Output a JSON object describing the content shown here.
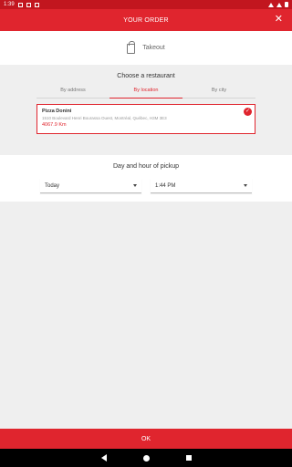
{
  "status_bar": {
    "time": "1:39"
  },
  "app_bar": {
    "title": "YOUR ORDER",
    "close_icon": "close-icon"
  },
  "order_type": {
    "label": "Takeout",
    "icon": "bag-icon"
  },
  "restaurant_picker": {
    "title": "Choose a restaurant",
    "tabs": [
      {
        "label": "By address",
        "active": false
      },
      {
        "label": "By location",
        "active": true
      },
      {
        "label": "By city",
        "active": false
      }
    ],
    "selected": {
      "name": "Pizza Donini",
      "address": "1510 Boulevard Henri Bourassa Ouest, Montréal, Québec, H3M 3E3",
      "distance": "4067.9 Km"
    }
  },
  "pickup": {
    "title": "Day and hour of pickup",
    "day": "Today",
    "time": "1:44 PM"
  },
  "footer": {
    "ok_label": "OK"
  },
  "colors": {
    "brand": "#e0252e",
    "status": "#c2161f"
  }
}
